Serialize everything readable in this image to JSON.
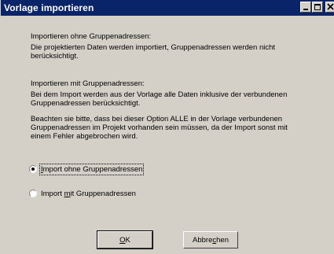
{
  "window": {
    "title": "Vorlage importieren"
  },
  "section1": {
    "heading": "Importieren ohne Gruppenadressen:",
    "line1": "Die projektierten Daten werden importiert, Gruppenadressen werden nicht",
    "line2": "berücksichtigt."
  },
  "section2": {
    "heading": "Importieren mit Gruppenadressen:",
    "line1": "Bei dem Import werden aus der Vorlage alle Daten inklusive der verbundenen",
    "line2": "Gruppenadressen berücksichtigt."
  },
  "section3": {
    "line1": "Beachten sie bitte, dass bei dieser Option ALLE in der Vorlage verbundenen",
    "line2": "Gruppenadressen im Projekt vorhanden sein müssen, da der Import sonst mit",
    "line3": "einem Fehler abgebrochen wird."
  },
  "options": {
    "without_groups": {
      "prefix": "",
      "accel": "I",
      "rest": "mport ohne Gruppenadressen",
      "selected": true
    },
    "with_groups": {
      "prefix": "Import ",
      "accel": "m",
      "rest": "it Gruppenadressen",
      "selected": false
    }
  },
  "buttons": {
    "ok": {
      "accel": "O",
      "rest": "K"
    },
    "cancel": {
      "prefix": "Abbre",
      "accel": "c",
      "rest": "hen"
    }
  }
}
